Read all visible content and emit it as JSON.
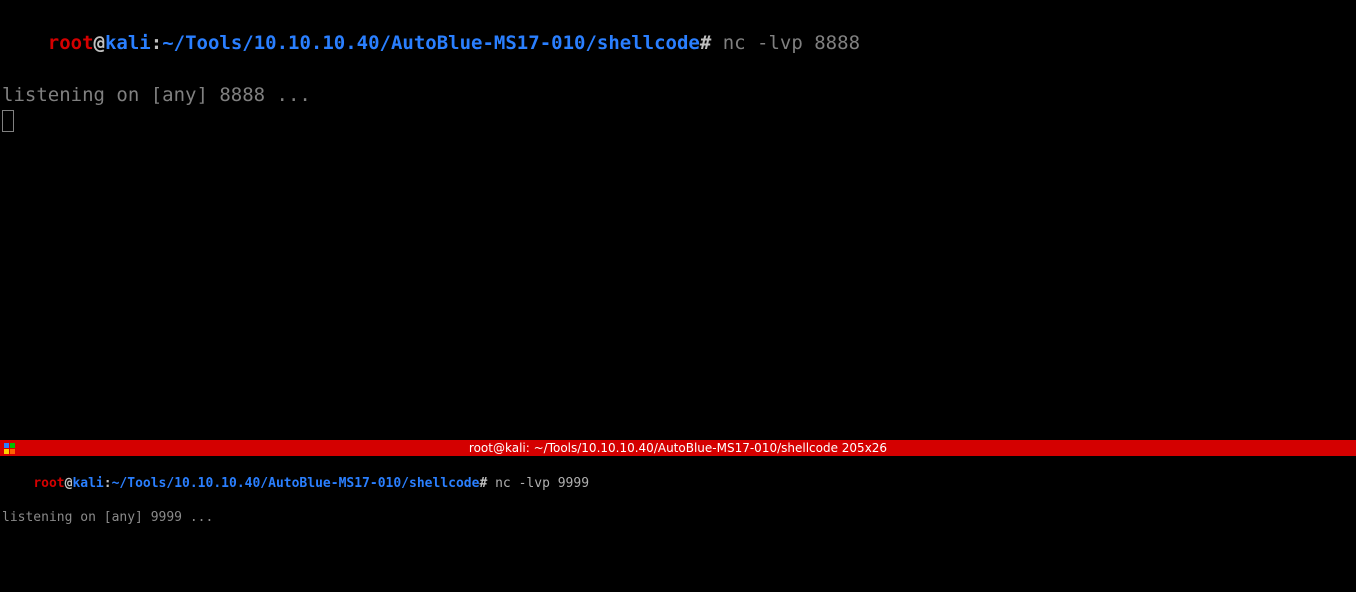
{
  "top_pane": {
    "prompt": {
      "user": "root",
      "at": "@",
      "host": "kali",
      "colon": ":",
      "path": "~/Tools/10.10.10.40/AutoBlue-MS17-010/shellcode",
      "hash": "#"
    },
    "command": " nc -lvp 8888",
    "output": "listening on [any] 8888 ..."
  },
  "divider": {
    "title": "root@kali: ~/Tools/10.10.10.40/AutoBlue-MS17-010/shellcode 205x26"
  },
  "bottom_pane": {
    "prompt": {
      "user": "root",
      "at": "@",
      "host": "kali",
      "colon": ":",
      "path": "~/Tools/10.10.10.40/AutoBlue-MS17-010/shellcode",
      "hash": "#"
    },
    "command": " nc -lvp 9999",
    "output": "listening on [any] 9999 ..."
  }
}
